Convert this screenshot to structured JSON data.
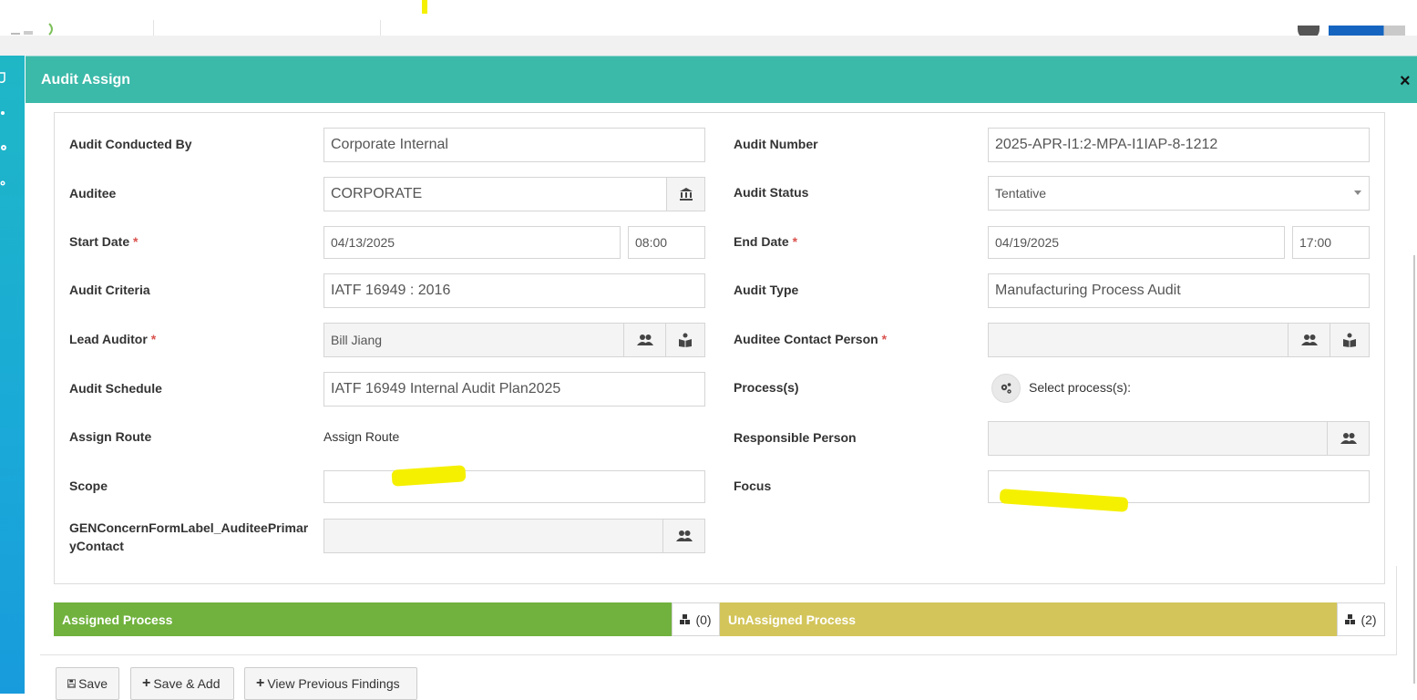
{
  "modal": {
    "title": "Audit Assign",
    "close_glyph": "×"
  },
  "form": {
    "audit_conducted_by": {
      "label": "Audit Conducted By",
      "value": "Corporate Internal"
    },
    "audit_number": {
      "label": "Audit Number",
      "value": "2025-APR-I1:2-MPA-I1IAP-8-1212"
    },
    "auditee": {
      "label": "Auditee",
      "value": "CORPORATE"
    },
    "audit_status": {
      "label": "Audit Status",
      "value": "Tentative"
    },
    "start_date": {
      "label": "Start Date",
      "required": "*",
      "date": "04/13/2025",
      "time": "08:00"
    },
    "end_date": {
      "label": "End Date",
      "required": "*",
      "date": "04/19/2025",
      "time": "17:00"
    },
    "audit_criteria": {
      "label": "Audit Criteria",
      "value": "IATF 16949 : 2016"
    },
    "audit_type": {
      "label": "Audit Type",
      "value": "Manufacturing Process Audit"
    },
    "lead_auditor": {
      "label": "Lead Auditor",
      "required": "*",
      "value": "Bill  Jiang"
    },
    "auditee_contact": {
      "label": "Auditee Contact Person",
      "required": "*",
      "value": ""
    },
    "audit_schedule": {
      "label": "Audit Schedule",
      "value": "IATF 16949 Internal Audit Plan2025"
    },
    "processes": {
      "label": "Process(s)",
      "select_text": "Select process(s):"
    },
    "assign_route": {
      "label": "Assign Route",
      "value": "Assign Route"
    },
    "responsible_person": {
      "label": "Responsible Person",
      "value": ""
    },
    "scope": {
      "label": "Scope",
      "value": ""
    },
    "focus": {
      "label": "Focus",
      "value": ""
    },
    "primary_contact": {
      "label_line1": "GENConcernFormLabel_AuditeePrimar",
      "label_line2": "yContact",
      "value": ""
    }
  },
  "process_bars": {
    "assigned": {
      "label": "Assigned Process",
      "count": "(0)"
    },
    "unassigned": {
      "label": "UnAssigned Process",
      "count": "(2)"
    }
  },
  "footer": {
    "save": "Save",
    "save_add": "Save & Add",
    "view_previous": "View Previous Findings"
  },
  "colors": {
    "header": "#3bb9a9",
    "assigned": "#70b23d",
    "unassigned": "#d3c55a",
    "required": "#d9534f",
    "highlight": "#f5f000"
  }
}
